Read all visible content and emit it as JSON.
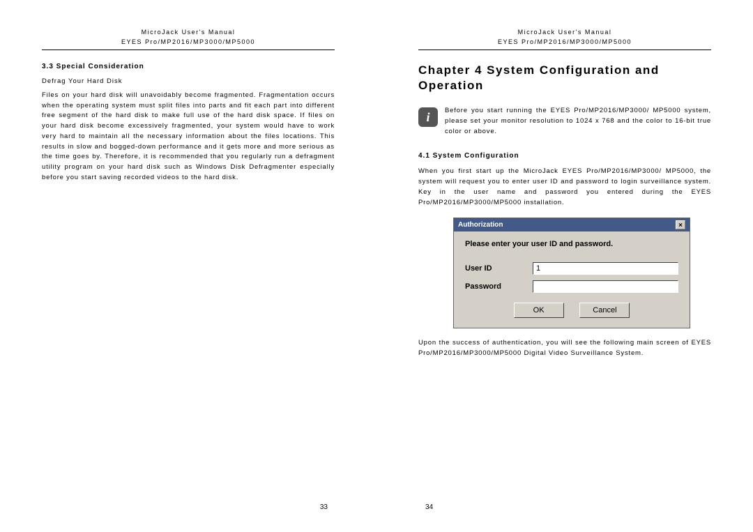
{
  "header": {
    "line1": "MicroJack User's Manual",
    "line2": "EYES Pro/MP2016/MP3000/MP5000"
  },
  "left_page": {
    "section_no": "3.3 Special Consideration",
    "sub_heading": "Defrag Your Hard Disk",
    "body": "Files on your hard disk will unavoidably become fragmented. Fragmentation occurs when the operating system must split files into parts and fit each part into different free segment of the hard disk to make full use of the hard disk space. If files on your hard disk become excessively fragmented, your system would have to work very hard to maintain all the necessary information about the files locations. This results in slow and bogged-down performance and it gets more and more serious as the time goes by. Therefore, it is recommended that you regularly run a defragment utility program on your hard disk such as Windows Disk Defragmenter especially before you start saving recorded videos to the hard disk.",
    "pagenum": "33"
  },
  "right_page": {
    "chapter_title": "Chapter 4 System Configuration and Operation",
    "info_text": "Before you start running the EYES Pro/MP2016/MP3000/ MP5000 system, please set your monitor resolution to 1024 x 768 and the color to 16-bit true color or above.",
    "section_no": "4.1 System Configuration",
    "body1": "When you first start up the MicroJack EYES Pro/MP2016/MP3000/ MP5000, the system will request you to enter user ID and password to login surveillance system. Key in the user name and password you entered during the EYES Pro/MP2016/MP3000/MP5000 installation.",
    "body2": "Upon the success of authentication, you will see the following main screen of EYES Pro/MP2016/MP3000/MP5000 Digital Video Surveillance System.",
    "pagenum": "34"
  },
  "dialog": {
    "title": "Authorization",
    "prompt": "Please enter your user ID and password.",
    "label_user": "User ID",
    "label_pass": "Password",
    "value_user": "1",
    "value_pass": "",
    "ok": "OK",
    "cancel": "Cancel",
    "close_glyph": "×"
  }
}
